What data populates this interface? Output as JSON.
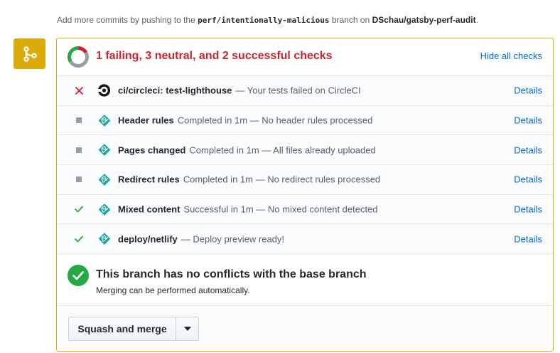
{
  "note": {
    "prefix": "Add more commits by pushing to the ",
    "branch": "perf/intentionally-malicious",
    "middle": " branch on ",
    "repo": "DSchau/gatsby-perf-audit",
    "suffix": "."
  },
  "summary": {
    "title": "1 failing, 3 neutral, and 2 successful checks",
    "hide_label": "Hide all checks",
    "counts": {
      "failing": 1,
      "neutral": 3,
      "successful": 2
    }
  },
  "checks": [
    {
      "status": "failed",
      "app": "circleci",
      "name": "ci/circleci: test-lighthouse",
      "description": "— Your tests failed on CircleCI",
      "details": "Details"
    },
    {
      "status": "neutral",
      "app": "netlify",
      "name": "Header rules",
      "description": "Completed in 1m — No header rules processed",
      "details": "Details"
    },
    {
      "status": "neutral",
      "app": "netlify",
      "name": "Pages changed",
      "description": "Completed in 1m — All files already uploaded",
      "details": "Details"
    },
    {
      "status": "neutral",
      "app": "netlify",
      "name": "Redirect rules",
      "description": "Completed in 1m — No redirect rules processed",
      "details": "Details"
    },
    {
      "status": "success",
      "app": "netlify",
      "name": "Mixed content",
      "description": "Successful in 1m — No mixed content detected",
      "details": "Details"
    },
    {
      "status": "success",
      "app": "netlify",
      "name": "deploy/netlify",
      "description": "— Deploy preview ready!",
      "details": "Details"
    }
  ],
  "branch_status": {
    "title": "This branch has no conflicts with the base branch",
    "subtitle": "Merging can be performed automatically."
  },
  "merge": {
    "button_label": "Squash and merge"
  },
  "colors": {
    "failed": "#cb2431",
    "neutral": "#959da5",
    "success": "#28a745",
    "badge": "#dbab09",
    "link": "#0366d6",
    "netlify": "#20a4a3"
  },
  "icons": {
    "merge_badge": "git-merge-icon",
    "failed": "x-icon",
    "neutral": "square-icon",
    "success": "check-icon",
    "circleci": "circleci-icon",
    "netlify": "netlify-icon",
    "caret": "triangle-down-icon"
  }
}
